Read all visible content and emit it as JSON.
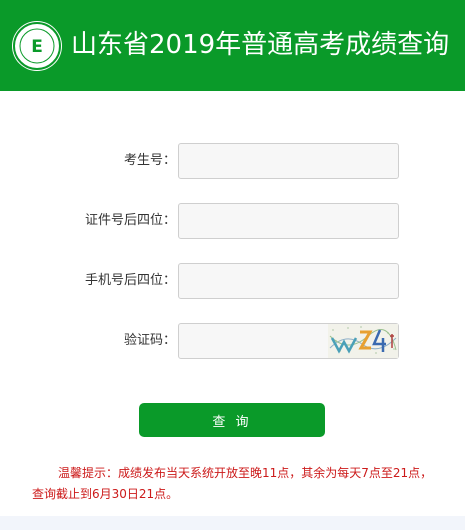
{
  "colors": {
    "brand_green": "#0a9a29",
    "notice_red": "#cc1a1a"
  },
  "header": {
    "logo_icon": "school-emblem-icon",
    "logo_letter": "E",
    "title": "山东省2019年普通高考成绩查询"
  },
  "form": {
    "exam_number": {
      "label": "考生号：",
      "value": "",
      "placeholder": ""
    },
    "id_last4": {
      "label": "证件号后四位：",
      "value": "",
      "placeholder": ""
    },
    "phone_last4": {
      "label": "手机号后四位：",
      "value": "",
      "placeholder": ""
    },
    "captcha": {
      "label": "验证码：",
      "value": "",
      "placeholder": "",
      "image_icon": "captcha-image-icon"
    },
    "submit_label": "查 询"
  },
  "notice": {
    "text": "温馨提示：成绩发布当天系统开放至晚11点，其余为每天7点至21点，查询截止到6月30日21点。"
  }
}
